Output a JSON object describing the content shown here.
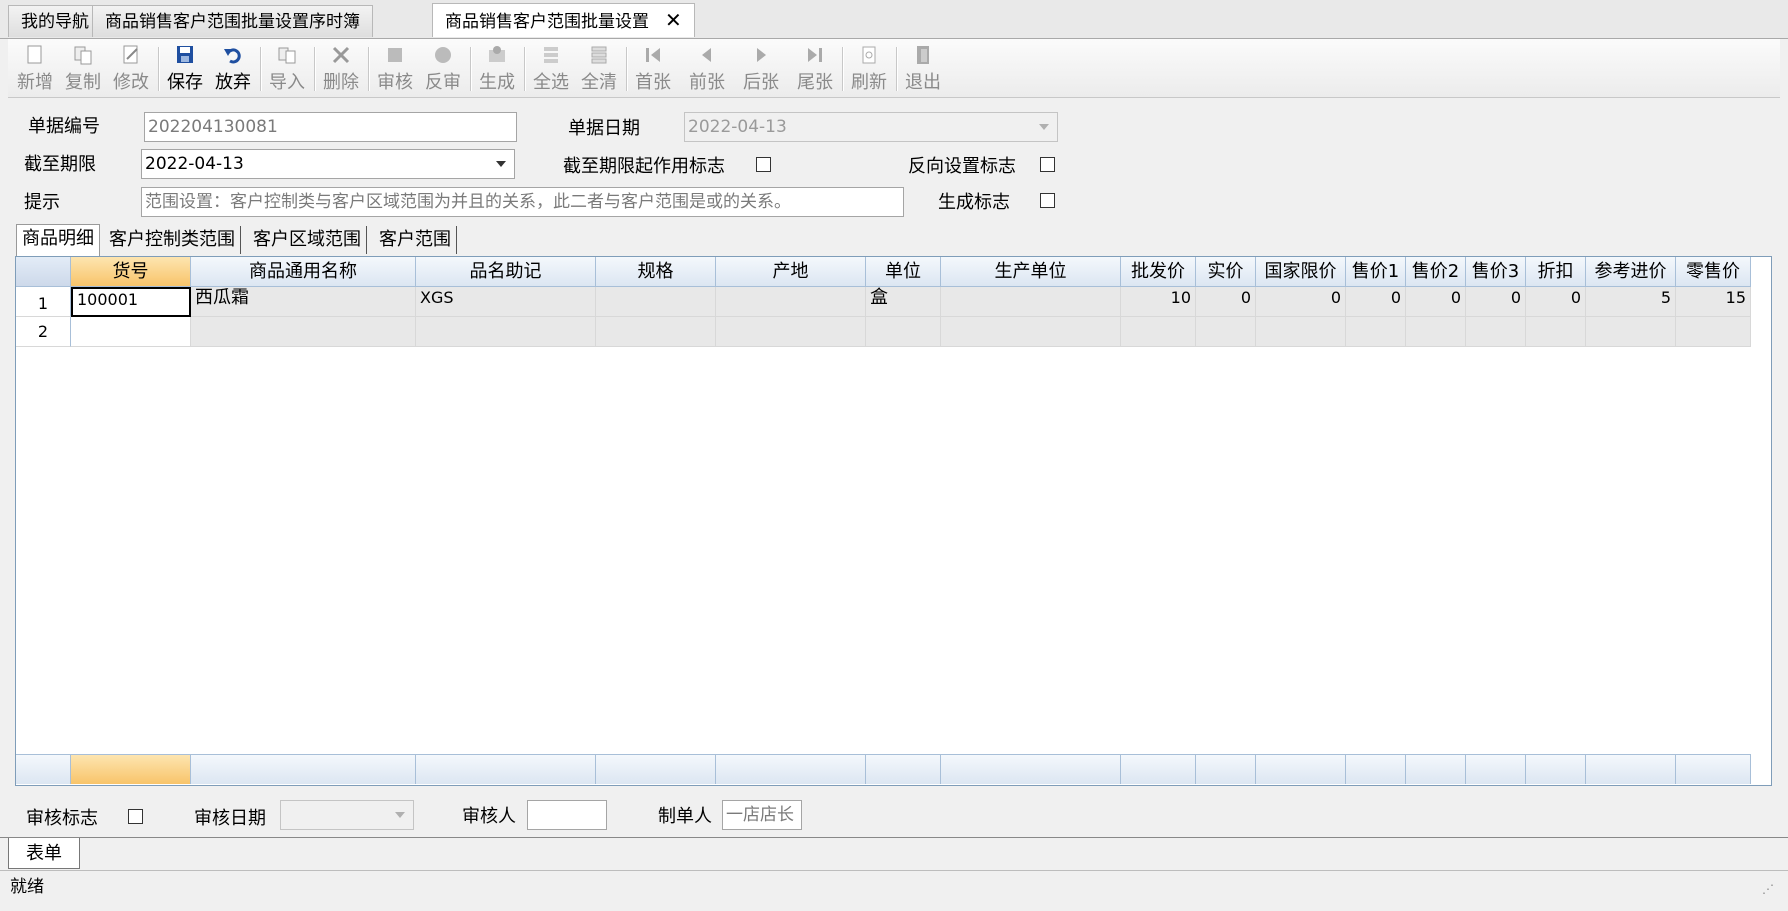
{
  "tabs": [
    {
      "label": "我的导航"
    },
    {
      "label": "商品销售客户范围批量设置序时簿"
    },
    {
      "label": "商品销售客户范围批量设置",
      "close": "✕"
    }
  ],
  "toolbar": [
    {
      "label": "新增",
      "icon": "new-doc-icon"
    },
    {
      "label": "复制",
      "icon": "copy-icon"
    },
    {
      "label": "修改",
      "icon": "edit-icon"
    },
    {
      "label": "保存",
      "icon": "save-icon"
    },
    {
      "label": "放弃",
      "icon": "undo-icon"
    },
    {
      "label": "导入",
      "icon": "import-icon"
    },
    {
      "label": "删除",
      "icon": "delete-icon"
    },
    {
      "label": "审核",
      "icon": "audit-icon"
    },
    {
      "label": "反审",
      "icon": "unaudit-icon"
    },
    {
      "label": "生成",
      "icon": "generate-icon"
    },
    {
      "label": "全选",
      "icon": "select-all-icon"
    },
    {
      "label": "全清",
      "icon": "clear-all-icon"
    },
    {
      "label": "首张",
      "icon": "first-icon"
    },
    {
      "label": "前张",
      "icon": "prev-icon"
    },
    {
      "label": "后张",
      "icon": "next-icon"
    },
    {
      "label": "尾张",
      "icon": "last-icon"
    },
    {
      "label": "刷新",
      "icon": "refresh-icon"
    },
    {
      "label": "退出",
      "icon": "exit-icon"
    }
  ],
  "form": {
    "doc_no_label": "单据编号",
    "doc_no_value": "202204130081",
    "doc_date_label": "单据日期",
    "doc_date_value": "2022-04-13",
    "deadline_label": "截至期限",
    "deadline_value": "2022-04-13",
    "deadline_flag_label": "截至期限起作用标志",
    "reverse_flag_label": "反向设置标志",
    "hint_label": "提示",
    "hint_value": "范围设置：客户控制类与客户区域范围为并且的关系，此二者与客户范围是或的关系。",
    "generate_flag_label": "生成标志"
  },
  "inner_tabs": [
    "商品明细",
    "客户控制类范围",
    "客户区域范围",
    "客户范围"
  ],
  "grid": {
    "columns": [
      "货号",
      "商品通用名称",
      "品名助记",
      "规格",
      "产地",
      "单位",
      "生产单位",
      "批发价",
      "实价",
      "国家限价",
      "售价1",
      "售价2",
      "售价3",
      "折扣",
      "参考进价",
      "零售价"
    ],
    "rows": [
      {
        "num": "1",
        "cells": [
          "100001",
          "西瓜霜",
          "XGS",
          "",
          "",
          "盒",
          "",
          "10",
          "0",
          "0",
          "0",
          "0",
          "0",
          "0",
          "5",
          "15"
        ]
      },
      {
        "num": "2",
        "cells": [
          "",
          "",
          "",
          "",
          "",
          "",
          "",
          "",
          "",
          "",
          "",
          "",
          "",
          "",
          "",
          ""
        ]
      }
    ]
  },
  "footer": {
    "audit_flag_label": "审核标志",
    "audit_date_label": "审核日期",
    "auditor_label": "审核人",
    "maker_label": "制单人",
    "maker_value": "一店店长"
  },
  "bottom_tab": "表单",
  "status": "就绪"
}
